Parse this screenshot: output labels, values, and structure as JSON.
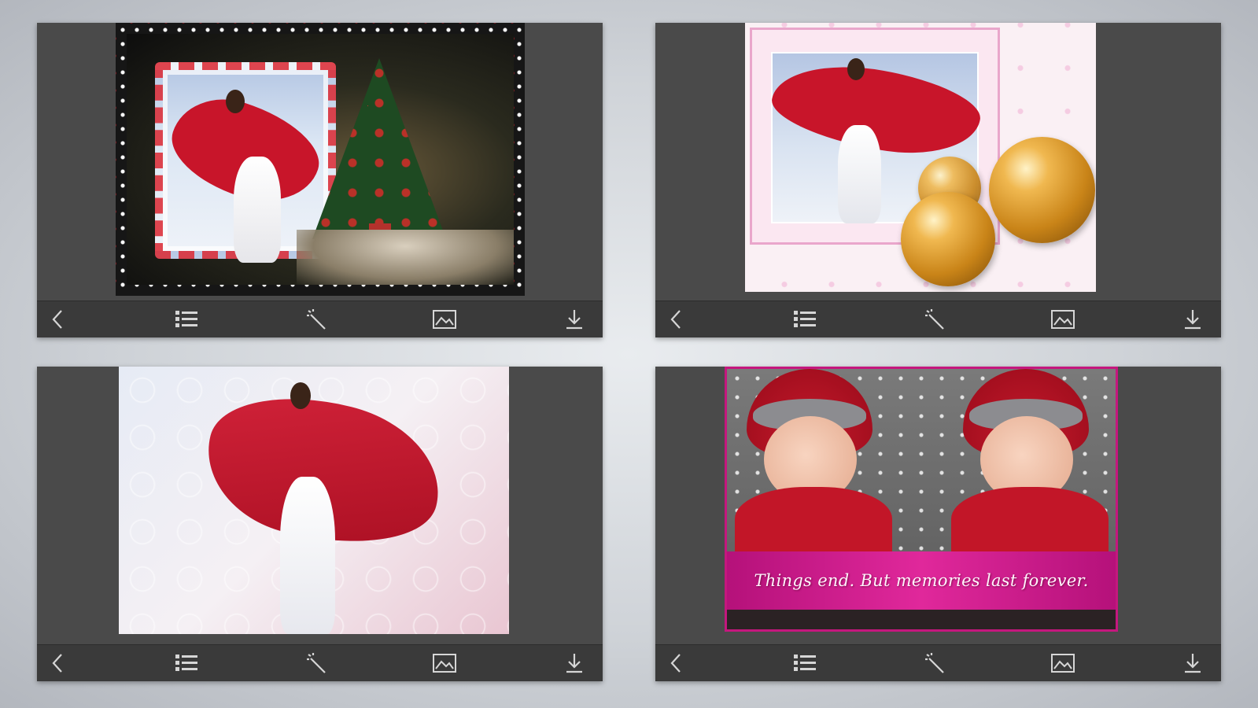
{
  "colors": {
    "page_background": "#cfd3d8",
    "panel": "#4a4a4a",
    "toolbar": "#3a3a3a",
    "toolbar_icon": "#d6d6d6",
    "caption_bar": "#d81f93"
  },
  "panels": [
    {
      "photo_theme": "dark frosty frame with Christmas tree",
      "toolbar": [
        "chevron-left-icon",
        "list-icon",
        "magic-wand-icon",
        "image-icon",
        "download-icon"
      ]
    },
    {
      "photo_theme": "pink frame with gold baubles",
      "toolbar": [
        "chevron-left-icon",
        "list-icon",
        "magic-wand-icon",
        "image-icon",
        "download-icon"
      ]
    },
    {
      "photo_theme": "white swirl frame",
      "toolbar": [
        "chevron-left-icon",
        "list-icon",
        "magic-wand-icon",
        "image-icon",
        "download-icon"
      ]
    },
    {
      "photo_theme": "two babies in Santa hats with caption",
      "caption": "Things end. But memories last forever.",
      "toolbar": [
        "chevron-left-icon",
        "list-icon",
        "magic-wand-icon",
        "image-icon",
        "download-icon"
      ]
    }
  ]
}
